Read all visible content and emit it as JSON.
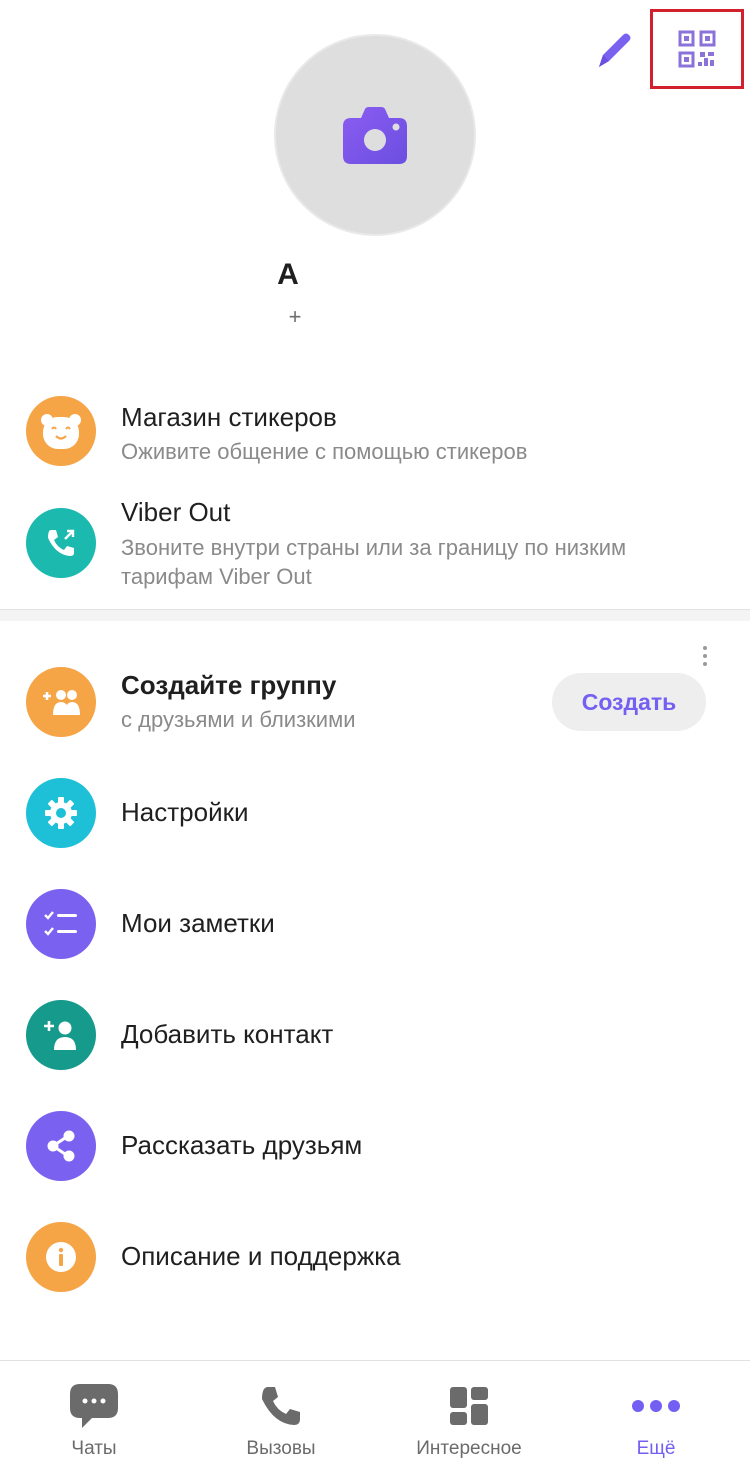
{
  "header": {
    "edit_icon": "pencil-icon",
    "qr_icon": "qr-code-icon"
  },
  "profile": {
    "avatar_icon": "camera-icon",
    "name": "A",
    "phone": "+"
  },
  "promos": [
    {
      "icon": "sticker-bear-icon",
      "title": "Магазин стикеров",
      "subtitle": "Оживите общение с помощью стикеров",
      "color": "#f5a446"
    },
    {
      "icon": "phone-out-icon",
      "title": "Viber Out",
      "subtitle": "Звоните внутри страны или за границу по низким тарифам Viber Out",
      "color": "#1bb9ae"
    }
  ],
  "group_card": {
    "title": "Создайте группу",
    "subtitle": "с друзьями и близкими",
    "button_label": "Создать",
    "icon": "add-group-icon",
    "color": "#f5a446"
  },
  "menu": [
    {
      "label": "Настройки",
      "icon": "gear-icon",
      "color": "#1ec0d8"
    },
    {
      "label": "Мои заметки",
      "icon": "notes-list-icon",
      "color": "#7b61f0"
    },
    {
      "label": "Добавить контакт",
      "icon": "add-contact-icon",
      "color": "#159a8c"
    },
    {
      "label": "Рассказать друзьям",
      "icon": "share-icon",
      "color": "#7b61f0"
    },
    {
      "label": "Описание и поддержка",
      "icon": "info-icon",
      "color": "#f5a446"
    }
  ],
  "bottom_nav": [
    {
      "label": "Чаты",
      "icon": "chat-bubble-icon",
      "active": false
    },
    {
      "label": "Вызовы",
      "icon": "phone-icon",
      "active": false
    },
    {
      "label": "Интересное",
      "icon": "explore-grid-icon",
      "active": false
    },
    {
      "label": "Ещё",
      "icon": "more-dots-icon",
      "active": true
    }
  ],
  "colors": {
    "accent": "#7360f2",
    "highlight_box": "#d3202e",
    "icon_gray": "#6b6b6b"
  }
}
